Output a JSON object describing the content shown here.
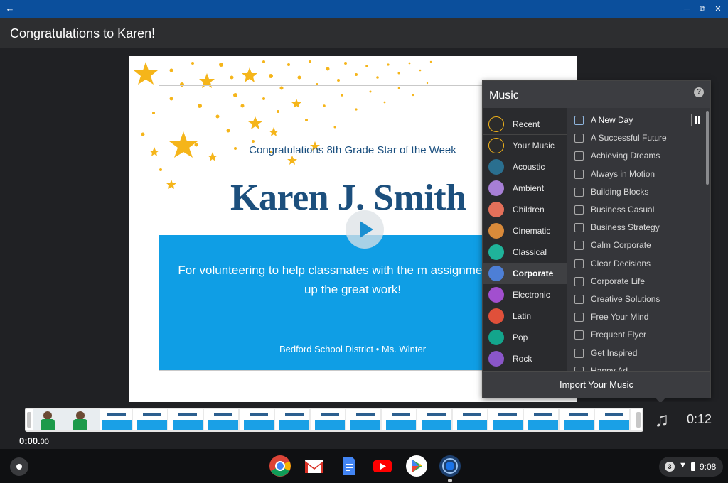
{
  "titlebar": {
    "back_icon": "arrow-left-icon",
    "controls": [
      "minimize-icon",
      "restore-icon",
      "close-icon"
    ]
  },
  "header": {
    "title": "Congratulations to Karen!"
  },
  "slide": {
    "subheading": "Congratulations 8th Grade Star of the Week",
    "name": "Karen J. Smith",
    "message": "For volunteering to help classmates with the m assignment. Keep up the great work!",
    "footer": "Bedford School District • Ms. Winter",
    "colors": {
      "banner": "#0f9ee5",
      "name": "#1c4f7d",
      "stars": "#f5b51a"
    }
  },
  "music_panel": {
    "title": "Music",
    "help_icon": "?",
    "genres": [
      {
        "label": "Recent",
        "icon": "star-icon",
        "color": "#2b2b2b"
      },
      {
        "label": "Your Music",
        "icon": "music-note-icon",
        "color": "#2b2b2b"
      },
      {
        "label": "Acoustic",
        "icon": "acoustic-icon",
        "color": "#2a6f8f"
      },
      {
        "label": "Ambient",
        "icon": "ambient-icon",
        "color": "#a77fd6"
      },
      {
        "label": "Children",
        "icon": "children-icon",
        "color": "#e4705a"
      },
      {
        "label": "Cinematic",
        "icon": "cinematic-icon",
        "color": "#d98a3a"
      },
      {
        "label": "Classical",
        "icon": "classical-icon",
        "color": "#1fb39a"
      },
      {
        "label": "Corporate",
        "icon": "corporate-icon",
        "color": "#4d7fd6"
      },
      {
        "label": "Electronic",
        "icon": "electronic-icon",
        "color": "#a24fcf"
      },
      {
        "label": "Latin",
        "icon": "latin-icon",
        "color": "#e0503a"
      },
      {
        "label": "Pop",
        "icon": "pop-icon",
        "color": "#13a58c"
      },
      {
        "label": "Rock",
        "icon": "rock-icon",
        "color": "#8a56c9"
      }
    ],
    "active_genre": "Corporate",
    "tracks": [
      "A New Day",
      "A Successful Future",
      "Achieving Dreams",
      "Always in Motion",
      "Building Blocks",
      "Business Casual",
      "Business Strategy",
      "Calm Corporate",
      "Clear Decisions",
      "Corporate Life",
      "Creative Solutions",
      "Free Your Mind",
      "Frequent Flyer",
      "Get Inspired",
      "Happy Ad"
    ],
    "import_label": "Import Your  Music"
  },
  "timeline": {
    "current_time": "0:00.",
    "current_time_ms": "00",
    "total_time": "0:12",
    "music_icon": "music-note-icon"
  },
  "shelf": {
    "apps": [
      "chrome-icon",
      "gmail-icon",
      "docs-icon",
      "youtube-icon",
      "play-store-icon",
      "screen-recorder-icon"
    ],
    "tray": {
      "notifications": "3",
      "clock": "9:08"
    }
  }
}
